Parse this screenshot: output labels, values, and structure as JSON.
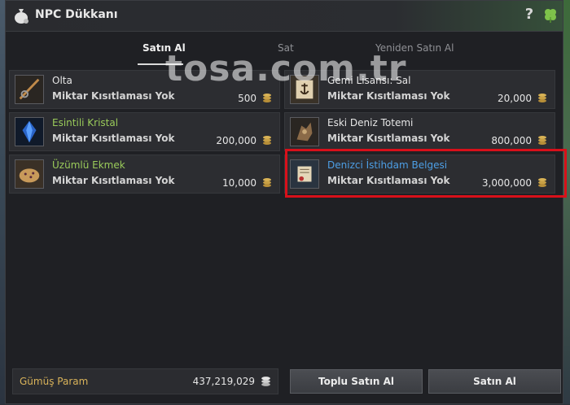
{
  "window": {
    "title": "NPC Dükkanı"
  },
  "tabs": [
    "Satın Al",
    "Sat",
    "Yeniden Satın Al"
  ],
  "watermark": "tosa.com.tr",
  "items": [
    {
      "name": "Olta",
      "limit": "Miktar Kısıtlaması Yok",
      "price": "500",
      "icon": "fishing-rod-icon",
      "name_color": "white"
    },
    {
      "name": "Gemi Lisansı: Sal",
      "limit": "Miktar Kısıtlaması Yok",
      "price": "20,000",
      "icon": "ship-license-icon",
      "name_color": "white"
    },
    {
      "name": "Esintili Kristal",
      "limit": "Miktar Kısıtlaması Yok",
      "price": "200,000",
      "icon": "crystal-icon",
      "name_color": "green"
    },
    {
      "name": "Eski Deniz Totemi",
      "limit": "Miktar Kısıtlaması Yok",
      "price": "800,000",
      "icon": "sea-totem-icon",
      "name_color": "white"
    },
    {
      "name": "Üzümlü Ekmek",
      "limit": "Miktar Kısıtlaması Yok",
      "price": "10,000",
      "icon": "bread-icon",
      "name_color": "green"
    },
    {
      "name": "Denizci İstihdam Belgesi",
      "limit": "Miktar Kısıtlaması Yok",
      "price": "3,000,000",
      "icon": "scroll-icon",
      "name_color": "blue",
      "highlighted": true
    }
  ],
  "footer": {
    "silver_label": "Gümüş Param",
    "silver_amount": "437,219,029",
    "bulk_buy": "Toplu Satın Al",
    "buy": "Satın Al"
  },
  "colors": {
    "green_name": "#9acb5a",
    "blue_name": "#4d9fe6",
    "highlight": "#d8101a",
    "silver_label": "#d9b35a"
  }
}
